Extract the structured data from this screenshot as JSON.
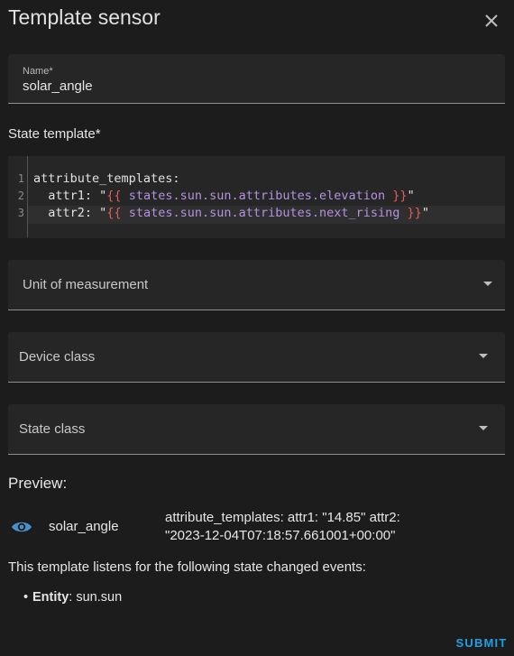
{
  "dialog": {
    "title": "Template sensor"
  },
  "name_field": {
    "label": "Name*",
    "value": "solar_angle"
  },
  "state_template": {
    "label": "State template*",
    "line_numbers": [
      "1",
      "2",
      "3"
    ],
    "lines": [
      {
        "plain": "attribute_templates:"
      },
      {
        "key": "  attr1: ",
        "q1": "\"",
        "open": "{{",
        "expr": " states.sun.sun.attributes.elevation ",
        "close": "}}",
        "q2": "\""
      },
      {
        "key": "  attr2: ",
        "q1": "\"",
        "open": "{{",
        "expr": " states.sun.sun.attributes.next_rising ",
        "close": "}}",
        "q2": "\""
      }
    ]
  },
  "selects": {
    "unit": {
      "label": "Unit of measurement"
    },
    "device_class": {
      "label": "Device class"
    },
    "state_class": {
      "label": "State class"
    }
  },
  "preview": {
    "label": "Preview:",
    "entity_name": "solar_angle",
    "state": "attribute_templates: attr1: \"14.85\" attr2: \"2023-12-04T07:18:57.661001+00:00\"",
    "icon": "eye-icon"
  },
  "listens": {
    "text": "This template listens for the following state changed events:",
    "bullet": "•",
    "items": [
      {
        "key": "Entity",
        "sep": ": ",
        "value": "sun.sun"
      }
    ]
  },
  "actions": {
    "submit_label": "SUBMIT"
  },
  "colors": {
    "background": "#1c1c1c",
    "field_background": "#262626",
    "accent": "#1ea0e6",
    "eye_icon": "#4a90c8",
    "template_brace": "#e25c5c",
    "template_expression": "#b591e0"
  }
}
